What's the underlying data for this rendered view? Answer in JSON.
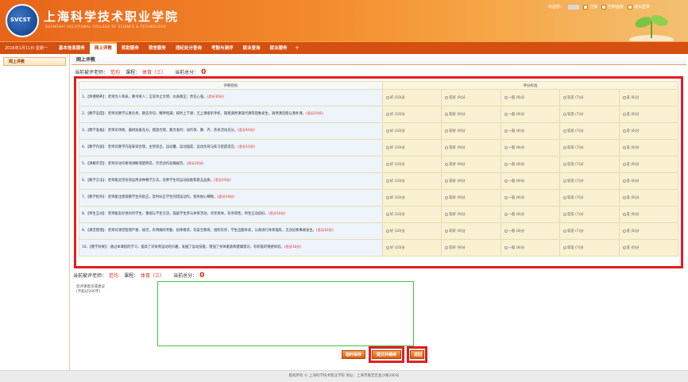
{
  "header": {
    "school_name": "上海科学技术职业学院",
    "school_name_en": "SHANGHAI VOCATIONAL COLLEGE OF SCIENCE & TECHNOLOGY",
    "logo_text": "SVCST",
    "welcome": "欢迎您：",
    "logout": "注销",
    "control_panel": "控制面板",
    "exit": "退出登录"
  },
  "nav": {
    "date": "2016年1月11日 星期一",
    "items": [
      "基本信息服务",
      "网上评教",
      "奖助服务",
      "宿舍服务",
      "违纪处分查询",
      "考勤与测评",
      "就业查询",
      "就业服务"
    ],
    "active_index": 1,
    "plus": "+"
  },
  "sidebar": {
    "items": [
      "网上评教"
    ]
  },
  "main": {
    "section_title": "网上评教",
    "current_teacher_label": "当前被评老师：",
    "teacher_name": "范均",
    "course_label": "课程：",
    "course_name": "体育（三）",
    "total_label": "当前总分：",
    "total_score": "0",
    "table": {
      "header_criteria": "评教指标",
      "header_standard": "评分标准",
      "criteria": [
        {
          "text": "1、【师德修养】：老师为人师表，教书育人；言谈举止文明、仪表端正；责任心强。",
          "points": "(总分10分)"
        },
        {
          "text": "2、【教学态度】：老师对教学认真负责，教态亲切，精神饱满；按时上下课；无上课接听手机、随意调停课或代课等现象发生，调停课后能认真补课。",
          "points": "(总分10分)"
        },
        {
          "text": "3、【教学准备】：老师对场地、器材准备充分，摆放合理，集合准时；动作快、静、齐，热身活动充分。",
          "points": "(总分10分)"
        },
        {
          "text": "4、【教学内容】：老师对教学内容安排合理，主项突出，运动量、运动强度、运动负荷与练习密度适宜。",
          "points": "(总分10分)"
        },
        {
          "text": "5、【讲解示范】：老师对动作要领讲解清楚明白，示范动作准确规范。",
          "points": "(总分10分)"
        },
        {
          "text": "6、【教学方法】：老师能灵活有效运用多种教学方法，培养学生的运动技能和意志品质。",
          "points": "(总分10分)"
        },
        {
          "text": "7、【教学指导】：老师能注意观察学生的反应，及时纠正学生的错误动作，指导耐心细致。",
          "points": "(总分10分)"
        },
        {
          "text": "8、【师生互动】：老师能友好地对待学生，重视与学生交流，鼓励学生参与体育活动，点评具体，有亲和性，师生互动良好。",
          "points": "(总分10分)"
        },
        {
          "text": "9、【课堂管理】：老师对课堂管理严格、规范，有明确的考勤、纪律要求，有安全教育，组织有序，学生出勤率高，认真进行体育锻炼，无违纪和事故发生。",
          "points": "(总分10分)"
        },
        {
          "text": "10、【教学效果】：通过本课程的学习，提高了对体育运动的兴趣，发展了运动技能，增强了身体素质和健康意识，有积极的情感体验。",
          "points": "(总分10分)"
        }
      ],
      "options": [
        "好 (10)分",
        "较好 (9)分",
        "一般 (8)分",
        "较差 (7)分",
        "差 (6)分"
      ]
    },
    "comment_label": "您评课意见或建议(不超过200字)",
    "comment_value": "",
    "buttons": {
      "save": "临时保存",
      "submit": "提交并继续",
      "back": "返回"
    }
  },
  "footer": {
    "text": "版权所有 © 上海科学技术职业学院 地址：上海市嘉定区金沙路280号"
  },
  "colors": {
    "brand_orange": "#e8641a",
    "nav_dark": "#d44f10",
    "highlight_red": "#e51c23",
    "highlight_green": "#3ec83e"
  }
}
